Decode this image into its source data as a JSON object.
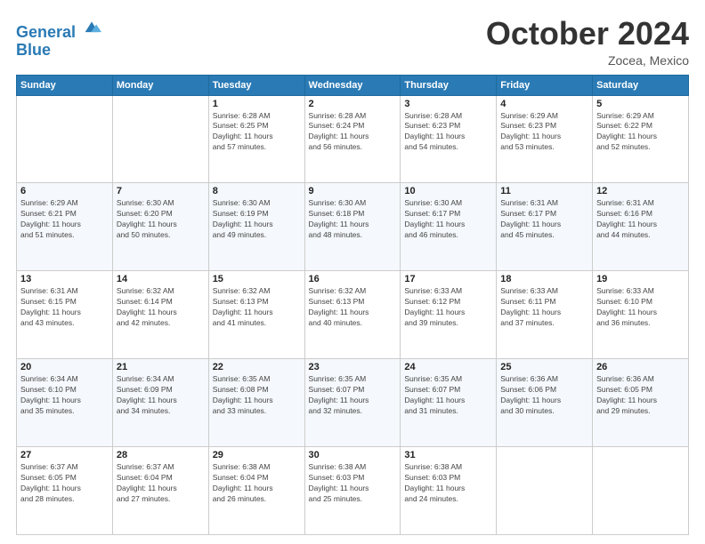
{
  "header": {
    "logo_line1": "General",
    "logo_line2": "Blue",
    "title": "October 2024",
    "subtitle": "Zocea, Mexico"
  },
  "weekdays": [
    "Sunday",
    "Monday",
    "Tuesday",
    "Wednesday",
    "Thursday",
    "Friday",
    "Saturday"
  ],
  "weeks": [
    [
      {
        "day": "",
        "info": ""
      },
      {
        "day": "",
        "info": ""
      },
      {
        "day": "1",
        "info": "Sunrise: 6:28 AM\nSunset: 6:25 PM\nDaylight: 11 hours\nand 57 minutes."
      },
      {
        "day": "2",
        "info": "Sunrise: 6:28 AM\nSunset: 6:24 PM\nDaylight: 11 hours\nand 56 minutes."
      },
      {
        "day": "3",
        "info": "Sunrise: 6:28 AM\nSunset: 6:23 PM\nDaylight: 11 hours\nand 54 minutes."
      },
      {
        "day": "4",
        "info": "Sunrise: 6:29 AM\nSunset: 6:23 PM\nDaylight: 11 hours\nand 53 minutes."
      },
      {
        "day": "5",
        "info": "Sunrise: 6:29 AM\nSunset: 6:22 PM\nDaylight: 11 hours\nand 52 minutes."
      }
    ],
    [
      {
        "day": "6",
        "info": "Sunrise: 6:29 AM\nSunset: 6:21 PM\nDaylight: 11 hours\nand 51 minutes."
      },
      {
        "day": "7",
        "info": "Sunrise: 6:30 AM\nSunset: 6:20 PM\nDaylight: 11 hours\nand 50 minutes."
      },
      {
        "day": "8",
        "info": "Sunrise: 6:30 AM\nSunset: 6:19 PM\nDaylight: 11 hours\nand 49 minutes."
      },
      {
        "day": "9",
        "info": "Sunrise: 6:30 AM\nSunset: 6:18 PM\nDaylight: 11 hours\nand 48 minutes."
      },
      {
        "day": "10",
        "info": "Sunrise: 6:30 AM\nSunset: 6:17 PM\nDaylight: 11 hours\nand 46 minutes."
      },
      {
        "day": "11",
        "info": "Sunrise: 6:31 AM\nSunset: 6:17 PM\nDaylight: 11 hours\nand 45 minutes."
      },
      {
        "day": "12",
        "info": "Sunrise: 6:31 AM\nSunset: 6:16 PM\nDaylight: 11 hours\nand 44 minutes."
      }
    ],
    [
      {
        "day": "13",
        "info": "Sunrise: 6:31 AM\nSunset: 6:15 PM\nDaylight: 11 hours\nand 43 minutes."
      },
      {
        "day": "14",
        "info": "Sunrise: 6:32 AM\nSunset: 6:14 PM\nDaylight: 11 hours\nand 42 minutes."
      },
      {
        "day": "15",
        "info": "Sunrise: 6:32 AM\nSunset: 6:13 PM\nDaylight: 11 hours\nand 41 minutes."
      },
      {
        "day": "16",
        "info": "Sunrise: 6:32 AM\nSunset: 6:13 PM\nDaylight: 11 hours\nand 40 minutes."
      },
      {
        "day": "17",
        "info": "Sunrise: 6:33 AM\nSunset: 6:12 PM\nDaylight: 11 hours\nand 39 minutes."
      },
      {
        "day": "18",
        "info": "Sunrise: 6:33 AM\nSunset: 6:11 PM\nDaylight: 11 hours\nand 37 minutes."
      },
      {
        "day": "19",
        "info": "Sunrise: 6:33 AM\nSunset: 6:10 PM\nDaylight: 11 hours\nand 36 minutes."
      }
    ],
    [
      {
        "day": "20",
        "info": "Sunrise: 6:34 AM\nSunset: 6:10 PM\nDaylight: 11 hours\nand 35 minutes."
      },
      {
        "day": "21",
        "info": "Sunrise: 6:34 AM\nSunset: 6:09 PM\nDaylight: 11 hours\nand 34 minutes."
      },
      {
        "day": "22",
        "info": "Sunrise: 6:35 AM\nSunset: 6:08 PM\nDaylight: 11 hours\nand 33 minutes."
      },
      {
        "day": "23",
        "info": "Sunrise: 6:35 AM\nSunset: 6:07 PM\nDaylight: 11 hours\nand 32 minutes."
      },
      {
        "day": "24",
        "info": "Sunrise: 6:35 AM\nSunset: 6:07 PM\nDaylight: 11 hours\nand 31 minutes."
      },
      {
        "day": "25",
        "info": "Sunrise: 6:36 AM\nSunset: 6:06 PM\nDaylight: 11 hours\nand 30 minutes."
      },
      {
        "day": "26",
        "info": "Sunrise: 6:36 AM\nSunset: 6:05 PM\nDaylight: 11 hours\nand 29 minutes."
      }
    ],
    [
      {
        "day": "27",
        "info": "Sunrise: 6:37 AM\nSunset: 6:05 PM\nDaylight: 11 hours\nand 28 minutes."
      },
      {
        "day": "28",
        "info": "Sunrise: 6:37 AM\nSunset: 6:04 PM\nDaylight: 11 hours\nand 27 minutes."
      },
      {
        "day": "29",
        "info": "Sunrise: 6:38 AM\nSunset: 6:04 PM\nDaylight: 11 hours\nand 26 minutes."
      },
      {
        "day": "30",
        "info": "Sunrise: 6:38 AM\nSunset: 6:03 PM\nDaylight: 11 hours\nand 25 minutes."
      },
      {
        "day": "31",
        "info": "Sunrise: 6:38 AM\nSunset: 6:03 PM\nDaylight: 11 hours\nand 24 minutes."
      },
      {
        "day": "",
        "info": ""
      },
      {
        "day": "",
        "info": ""
      }
    ]
  ]
}
